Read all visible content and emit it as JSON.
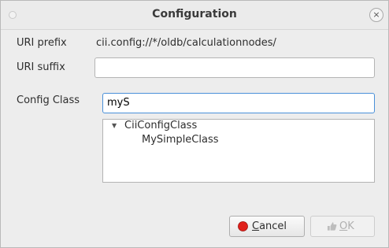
{
  "window": {
    "title": "Configuration",
    "close_glyph": "×"
  },
  "form": {
    "uri_prefix_label": "URI prefix",
    "uri_prefix_value": "cii.config://*/oldb/calculationnodes/",
    "uri_suffix_label": "URI suffix",
    "uri_suffix_value": "",
    "config_class_label": "Config Class",
    "config_class_value": "myS"
  },
  "tree": {
    "expander_glyph": "▼",
    "root_label": "CiiConfigClass",
    "child_label": "MySimpleClass"
  },
  "buttons": {
    "cancel_mnemonic": "C",
    "cancel_rest": "ancel",
    "cancel_icon": "stop-icon",
    "cancel_icon_color": "#e0201b",
    "ok_mnemonic": "O",
    "ok_rest": "K",
    "ok_icon": "thumbs-up-icon"
  }
}
